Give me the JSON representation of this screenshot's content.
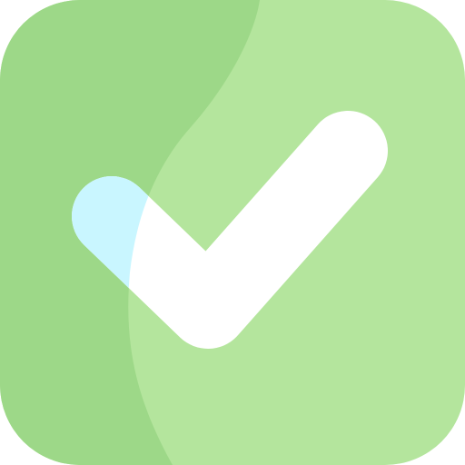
{
  "icon": {
    "name": "checkmark-icon",
    "colors": {
      "tile_dark": "#9dd888",
      "tile_light": "#b4e59d",
      "check": "#ffffff",
      "check_highlight": "#c9f6ff"
    }
  }
}
